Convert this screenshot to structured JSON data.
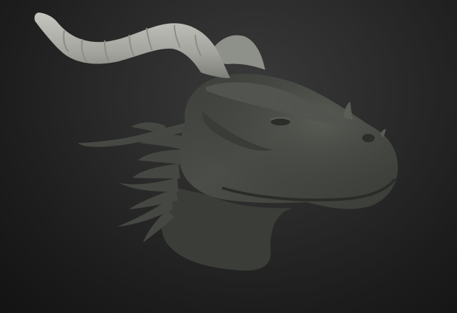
{
  "scene": {
    "subject": "dragon-head-sculpt",
    "colors": {
      "background_center": "#3a3a3a",
      "background_edge": "#131313",
      "horn": "#a9aba4",
      "skin": "#4a4d47",
      "skin_shadow": "#2f312d",
      "skin_highlight": "#62665e"
    }
  }
}
